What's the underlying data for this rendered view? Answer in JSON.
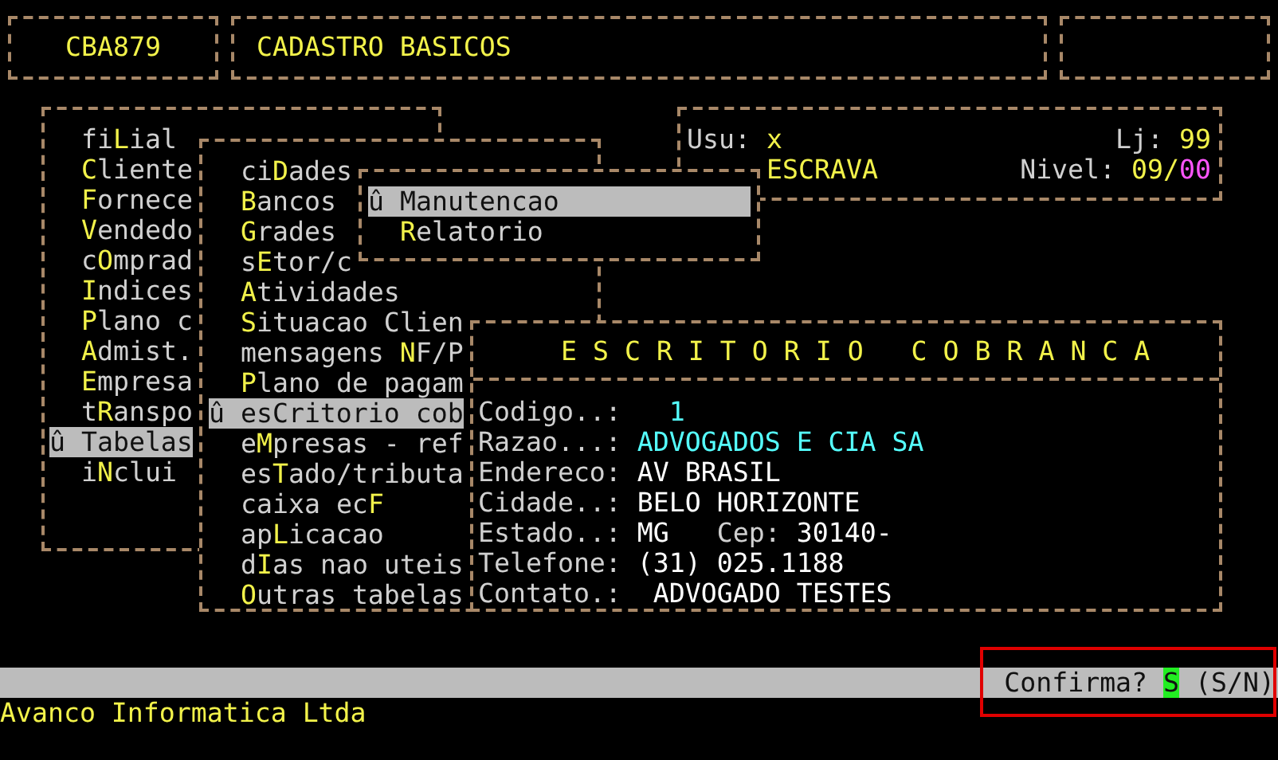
{
  "header": {
    "program_code": "CBA879",
    "title": "CADASTRO BASICOS"
  },
  "session": {
    "user_label": "Usu:",
    "user": "x",
    "store_label": "Lj:",
    "store": "99",
    "mode": "ESCRAVA",
    "level_label": "Nivel:",
    "level_main": "09/",
    "level_sub": "00"
  },
  "main_menu": {
    "items": [
      {
        "text_before": "fi",
        "hotkey": "L",
        "text_after": "ial",
        "selected": false
      },
      {
        "hotkey": "C",
        "text_after": "liente",
        "selected": false
      },
      {
        "hotkey": "F",
        "text_after": "ornece",
        "selected": false
      },
      {
        "hotkey": "V",
        "text_after": "endedo",
        "selected": false
      },
      {
        "text_before": "c",
        "hotkey": "O",
        "text_after": "mprad",
        "selected": false
      },
      {
        "hotkey": "I",
        "text_after": "ndices",
        "selected": false
      },
      {
        "hotkey": "P",
        "text_after": "lano c",
        "selected": false
      },
      {
        "hotkey": "A",
        "text_after": "dmist.",
        "selected": false
      },
      {
        "hotkey": "E",
        "text_after": "mpresa",
        "selected": false
      },
      {
        "text_before": "t",
        "hotkey": "R",
        "text_after": "anspo",
        "selected": false
      },
      {
        "text_before": "û Tabelas",
        "selected": true
      },
      {
        "text_before": "i",
        "hotkey": "N",
        "text_after": "clui",
        "selected": false
      }
    ]
  },
  "table_menu": {
    "items": [
      {
        "text_before": "ci",
        "hotkey": "D",
        "text_after": "ades",
        "selected": false
      },
      {
        "hotkey": "B",
        "text_after": "ancos",
        "selected": false
      },
      {
        "hotkey": "G",
        "text_after": "rades",
        "selected": false
      },
      {
        "text_before": "s",
        "hotkey": "E",
        "text_after": "tor/c",
        "selected": false
      },
      {
        "hotkey": "A",
        "text_after": "tividades",
        "selected": false
      },
      {
        "hotkey": "S",
        "text_after": "ituacao Clien",
        "selected": false
      },
      {
        "text_before": "mensagens ",
        "hotkey": "N",
        "text_after": "F/P",
        "selected": false
      },
      {
        "hotkey": "P",
        "text_after": "lano de pagam",
        "selected": false
      },
      {
        "text_before": "û esCritorio cob",
        "selected": true
      },
      {
        "text_before": "e",
        "hotkey": "M",
        "text_after": "presas - ref",
        "selected": false
      },
      {
        "text_before": "es",
        "hotkey": "T",
        "text_after": "ado/tributa",
        "selected": false
      },
      {
        "text_before": "caixa ec",
        "hotkey": "F",
        "selected": false
      },
      {
        "text_before": "ap",
        "hotkey": "L",
        "text_after": "icacao",
        "selected": false
      },
      {
        "text_before": "d",
        "hotkey": "I",
        "text_after": "as nao uteis",
        "selected": false
      },
      {
        "hotkey": "O",
        "text_after": "utras tabelas",
        "selected": false
      }
    ]
  },
  "action_menu": {
    "items": [
      {
        "text_before": "û Manutencao",
        "selected": true
      },
      {
        "hotkey": "R",
        "text_after": "elatorio",
        "selected": false
      }
    ]
  },
  "form": {
    "title": "E S C R I T O R I O   C O B R A N C A",
    "fields": [
      {
        "label": "Codigo..:",
        "value": "  1",
        "color": "#55ffff"
      },
      {
        "label": "Razao...:",
        "value": "ADVOGADOS E CIA SA",
        "color": "#55ffff"
      },
      {
        "label": "Endereco:",
        "value": "AV BRASIL",
        "color": "#ffffff"
      },
      {
        "label": "Cidade..:",
        "value": "BELO HORIZONTE",
        "color": "#ffffff"
      },
      {
        "label": "Estado..:",
        "value": "MG",
        "color": "#ffffff",
        "extra_label": "Cep:",
        "extra_value": "30140-"
      },
      {
        "label": "Telefone:",
        "value": "(31) 025.1188",
        "color": "#ffffff"
      },
      {
        "label": "Contato.:",
        "value": " ADVOGADO TESTES",
        "color": "#ffffff"
      }
    ]
  },
  "status_bar": {
    "prompt": "Confirma?",
    "answer": "S",
    "options": "(S/N)"
  },
  "footer": {
    "company": "Avanco Informatica Ltda"
  }
}
